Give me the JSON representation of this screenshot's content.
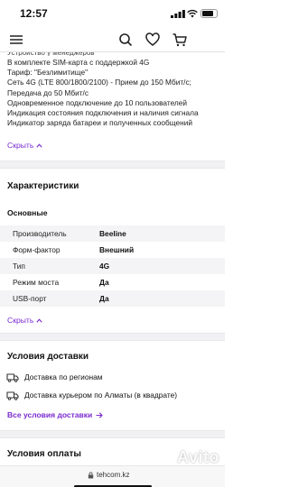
{
  "status_bar": {
    "time": "12:57"
  },
  "colors": {
    "accent": "#7a2bd0",
    "stripe": "#f4f4f6",
    "divider": "#f1f1f3"
  },
  "header": {
    "icons": [
      "menu-icon",
      "search-icon",
      "heart-icon",
      "cart-icon"
    ]
  },
  "description": {
    "cut_line": "Устройство у менеджеров",
    "lines": [
      "В комплекте SIM-карта с поддержкой 4G",
      "Тариф: \"Безлимитище\"",
      "Сеть 4G (LTE 800/1800/2100) - Прием до 150 Мбит/с;",
      "Передача до 50 Мбит/с",
      "Одновременное подключение до 10 пользователей",
      "Индикация состояния подключения и наличия сигнала",
      "Индикатор заряда батареи и полученных сообщений"
    ],
    "collapse_label": "Скрыть"
  },
  "specs": {
    "title": "Характеристики",
    "subtitle": "Основные",
    "rows": [
      {
        "key": "Производитель",
        "value": "Beeline"
      },
      {
        "key": "Форм-фактор",
        "value": "Внешний"
      },
      {
        "key": "Тип",
        "value": "4G"
      },
      {
        "key": "Режим моста",
        "value": "Да"
      },
      {
        "key": "USB-порт",
        "value": "Да"
      }
    ],
    "collapse_label": "Скрыть"
  },
  "delivery": {
    "title": "Условия доставки",
    "items": [
      {
        "label": "Доставка по регионам",
        "icon": "truck-icon"
      },
      {
        "label": "Доставка курьером по Алматы (в квадрате)",
        "icon": "truck-icon"
      }
    ],
    "all_link": "Все условия доставки"
  },
  "payment": {
    "title": "Условия оплаты"
  },
  "browser": {
    "url": "tehcom.kz"
  },
  "watermark": {
    "text": "Avito"
  }
}
